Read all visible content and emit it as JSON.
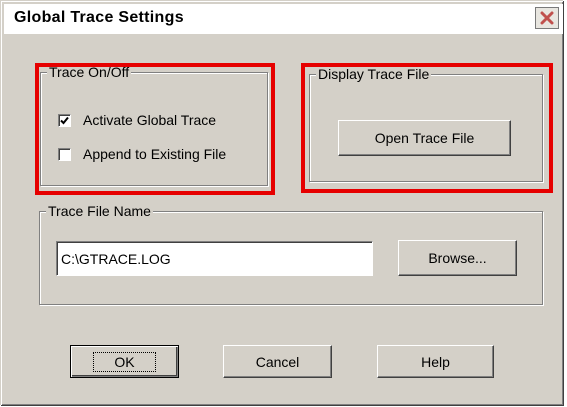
{
  "window": {
    "title": "Global Trace Settings",
    "close_icon": "close-icon"
  },
  "trace_onoff": {
    "label": "Trace On/Off",
    "activate_label": "Activate Global Trace",
    "activate_checked": true,
    "append_label": "Append to Existing File",
    "append_checked": false
  },
  "display_trace": {
    "label": "Display Trace File",
    "open_button": "Open Trace File"
  },
  "trace_file": {
    "label": "Trace File Name",
    "value": "C:\\GTRACE.LOG",
    "browse_button": "Browse..."
  },
  "buttons": {
    "ok": "OK",
    "cancel": "Cancel",
    "help": "Help"
  },
  "colors": {
    "highlight": "#e60000",
    "dialog_bg": "#d4d0c8"
  }
}
